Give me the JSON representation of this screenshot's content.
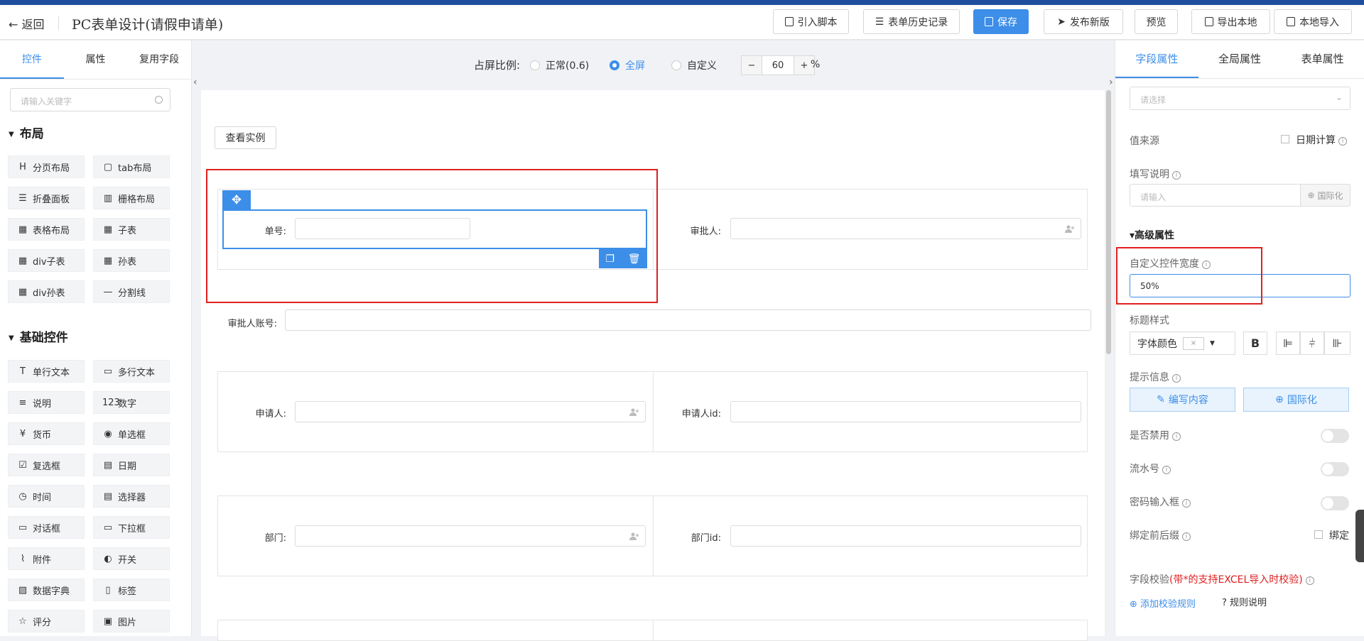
{
  "header": {
    "back_label": "返回",
    "title": "PC表单设计(请假申请单)",
    "buttons": {
      "import_script": "引入脚本",
      "history": "表单历史记录",
      "save": "保存",
      "publish": "发布新版",
      "preview": "预览",
      "export": "导出本地",
      "import_local": "本地导入"
    }
  },
  "left": {
    "tabs": [
      "控件",
      "属性",
      "复用字段"
    ],
    "search_placeholder": "请输入关键字",
    "layout_title": "布局",
    "layout_items": [
      {
        "icon": "H",
        "label": "分页布局"
      },
      {
        "icon": "▢",
        "label": "tab布局"
      },
      {
        "icon": "☰",
        "label": "折叠面板"
      },
      {
        "icon": "▥",
        "label": "栅格布局"
      },
      {
        "icon": "▦",
        "label": "表格布局"
      },
      {
        "icon": "▦",
        "label": "子表"
      },
      {
        "icon": "▦",
        "label": "div子表"
      },
      {
        "icon": "▦",
        "label": "孙表"
      },
      {
        "icon": "▦",
        "label": "div孙表"
      },
      {
        "icon": "—",
        "label": "分割线"
      }
    ],
    "basic_title": "基础控件",
    "basic_items": [
      {
        "icon": "T",
        "label": "单行文本"
      },
      {
        "icon": "▭",
        "label": "多行文本"
      },
      {
        "icon": "≡",
        "label": "说明"
      },
      {
        "icon": "123",
        "label": "数字"
      },
      {
        "icon": "¥",
        "label": "货币"
      },
      {
        "icon": "◉",
        "label": "单选框"
      },
      {
        "icon": "☑",
        "label": "复选框"
      },
      {
        "icon": "▤",
        "label": "日期"
      },
      {
        "icon": "◷",
        "label": "时间"
      },
      {
        "icon": "▤",
        "label": "选择器"
      },
      {
        "icon": "▭",
        "label": "对话框"
      },
      {
        "icon": "▭",
        "label": "下拉框"
      },
      {
        "icon": "⌇",
        "label": "附件"
      },
      {
        "icon": "◐",
        "label": "开关"
      },
      {
        "icon": "▨",
        "label": "数据字典"
      },
      {
        "icon": "▯",
        "label": "标签"
      },
      {
        "icon": "☆",
        "label": "评分"
      },
      {
        "icon": "▣",
        "label": "图片"
      }
    ]
  },
  "center": {
    "ratio_label": "占屏比例:",
    "options": [
      "正常(0.6)",
      "全屏",
      "自定义"
    ],
    "selected": "全屏",
    "stepper_minus": "−",
    "stepper_value": "60",
    "stepper_plus": "+",
    "pct": "%",
    "example_button": "查看实例",
    "fields": {
      "order_no": "单号:",
      "approver": "审批人:",
      "approver_account": "审批人账号:",
      "applicant": "申请人:",
      "applicant_id": "申请人id:",
      "dept": "部门:",
      "dept_id": "部门id:"
    }
  },
  "right": {
    "tabs": [
      "字段属性",
      "全局属性",
      "表单属性"
    ],
    "select_placeholder": "请选择",
    "value_source": "值来源",
    "date_calc": "日期计算",
    "fill_desc": "填写说明",
    "input_placeholder": "请输入",
    "i18n": "国际化",
    "advanced": "高级属性",
    "custom_width_label": "自定义控件宽度",
    "custom_width_value": "50%",
    "title_style": "标题样式",
    "font_color": "字体颜色",
    "bold": "B",
    "hint": "提示信息",
    "edit_content": "编写内容",
    "i18n2": "国际化",
    "disabled": "是否禁用",
    "serial": "流水号",
    "password": "密码输入框",
    "prefix": "绑定前后缀",
    "bind": "绑定",
    "validation_label": "字段校验",
    "validation_note": "(带*的支持EXCEL导入时校验)",
    "add_rule": "添加校验规则",
    "rule_desc": "规则说明"
  },
  "colors": {
    "accent": "#3d8ee8",
    "highlight": "#e02020",
    "topbar": "#1f4e9e"
  }
}
